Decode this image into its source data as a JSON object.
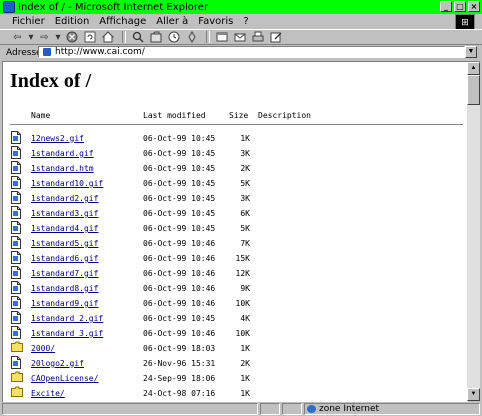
{
  "window": {
    "title": "Index of / - Microsoft Internet Explorer",
    "buttons": {
      "minimize": "_",
      "maximize": "□",
      "close": "×"
    }
  },
  "menu": [
    "Fichier",
    "Edition",
    "Affichage",
    "Aller à",
    "Favoris",
    "?"
  ],
  "toolbar": {
    "icons": [
      "back-icon",
      "forward-icon",
      "stop-icon",
      "refresh-icon",
      "home-icon",
      "search-icon",
      "favorites-icon",
      "history-icon",
      "channels-icon",
      "fullscreen-icon",
      "mail-icon",
      "print-icon",
      "edit-icon"
    ]
  },
  "address": {
    "label": "Adresse",
    "url": "http://www.cai.com/"
  },
  "page": {
    "title": "Index of /",
    "columns": {
      "name": "Name",
      "modified": "Last modified",
      "size": "Size",
      "description": "Description"
    }
  },
  "files": [
    {
      "name": "12news2.gif",
      "modified": "06-Oct-99 10:45",
      "size": "1K",
      "type": "file"
    },
    {
      "name": "1standard.gif",
      "modified": "06-Oct-99 10:45",
      "size": "3K",
      "type": "file"
    },
    {
      "name": "1standard.htm",
      "modified": "06-Oct-99 10:45",
      "size": "2K",
      "type": "file"
    },
    {
      "name": "1standard10.gif",
      "modified": "06-Oct-99 10:45",
      "size": "5K",
      "type": "file"
    },
    {
      "name": "1standard2.gif",
      "modified": "06-Oct-99 10:45",
      "size": "3K",
      "type": "file"
    },
    {
      "name": "1standard3.gif",
      "modified": "06-Oct-99 10:45",
      "size": "6K",
      "type": "file"
    },
    {
      "name": "1standard4.gif",
      "modified": "06-Oct-99 10:45",
      "size": "5K",
      "type": "file"
    },
    {
      "name": "1standard5.gif",
      "modified": "06-Oct-99 10:46",
      "size": "7K",
      "type": "file"
    },
    {
      "name": "1standard6.gif",
      "modified": "06-Oct-99 10:46",
      "size": "15K",
      "type": "file"
    },
    {
      "name": "1standard7.gif",
      "modified": "06-Oct-99 10:46",
      "size": "12K",
      "type": "file"
    },
    {
      "name": "1standard8.gif",
      "modified": "06-Oct-99 10:46",
      "size": "9K",
      "type": "file"
    },
    {
      "name": "1standard9.gif",
      "modified": "06-Oct-99 10:46",
      "size": "10K",
      "type": "file"
    },
    {
      "name": "1standard_2.gif",
      "modified": "06-Oct-99 10:45",
      "size": "4K",
      "type": "file"
    },
    {
      "name": "1standard_3.gif",
      "modified": "06-Oct-99 10:46",
      "size": "10K",
      "type": "file"
    },
    {
      "name": "2000/",
      "modified": "06-Oct-99 18:03",
      "size": "1K",
      "type": "folder"
    },
    {
      "name": "20logo2.gif",
      "modified": "26-Nov-96 15:31",
      "size": "2K",
      "type": "file"
    },
    {
      "name": "CAOpenLicense/",
      "modified": "24-Sep-99 18:06",
      "size": "1K",
      "type": "folder"
    },
    {
      "name": "Excite/",
      "modified": "24-Oct-98 07:16",
      "size": "1K",
      "type": "folder"
    }
  ],
  "status": {
    "zone": "zone Internet"
  },
  "colors": {
    "titlebar": "#00ff00",
    "link": "#000080",
    "chrome": "#c0c0c0"
  }
}
